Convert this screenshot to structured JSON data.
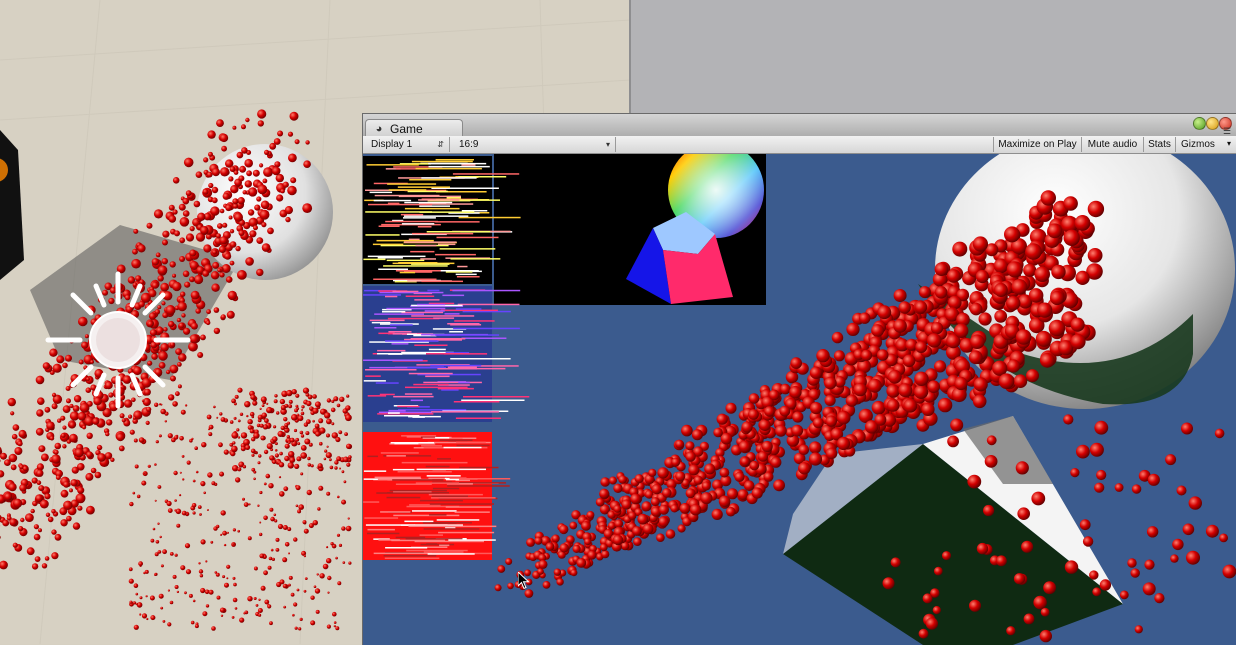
{
  "game_window": {
    "tab_label": "Game",
    "tab_icon": "unity-pacman-icon"
  },
  "toolbar": {
    "display": "Display 1",
    "aspect": "16:9",
    "maximize_on_play": "Maximize on Play",
    "mute_audio": "Mute audio",
    "stats": "Stats",
    "gizmos": "Gizmos"
  },
  "colors": {
    "scene_background": "#d7d1c3",
    "game_background": "#3b5b8e",
    "particle_red": "#d40000",
    "toolbar": "#e6e6e6"
  },
  "icons": {
    "display_dropdown_arrow": "updown-arrows-icon",
    "gizmos_dropdown_arrow": "triangle-down-icon",
    "window_menu": "hamburger-menu-icon",
    "light_gizmo": "sun-light-gizmo-icon",
    "cursor": "mouse-pointer-icon"
  }
}
